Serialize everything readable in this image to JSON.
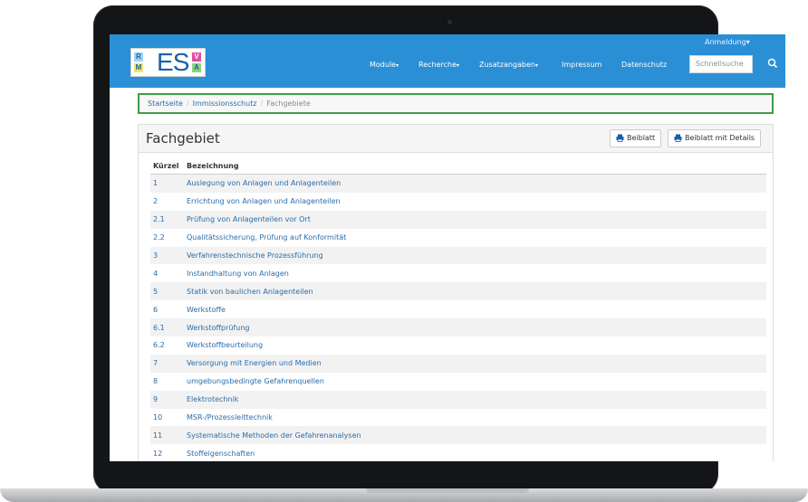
{
  "navbar": {
    "login_label": "Anmeldung",
    "items": [
      {
        "label": "Module",
        "dropdown": true
      },
      {
        "label": "Recherche",
        "dropdown": true
      },
      {
        "label": "Zusatzangaben",
        "dropdown": true
      },
      {
        "label": "Impressum",
        "dropdown": false
      },
      {
        "label": "Datenschutz",
        "dropdown": false
      }
    ],
    "search_placeholder": "Schnellsuche",
    "logo_letters": [
      "R",
      "M",
      "E",
      "S",
      "V",
      "A"
    ],
    "color": "#2b8fd6"
  },
  "breadcrumb": {
    "items": [
      "Startseite",
      "Immissionsschutz",
      "Fachgebiete"
    ],
    "highlight_color": "#3d9d4a"
  },
  "panel": {
    "title": "Fachgebiet",
    "btn_beiblatt": "Beiblatt",
    "btn_beiblatt_details": "Beiblatt mit Details"
  },
  "table": {
    "headers": [
      "Kürzel",
      "Bezeichnung"
    ],
    "rows": [
      {
        "k": "1",
        "b": "Auslegung von Anlagen und Anlagenteilen"
      },
      {
        "k": "2",
        "b": "Errichtung von Anlagen und Anlagenteilen"
      },
      {
        "k": "2.1",
        "b": "Prüfung von Anlagenteilen vor Ort"
      },
      {
        "k": "2.2",
        "b": "Qualitätssicherung, Prüfung auf Konformität"
      },
      {
        "k": "3",
        "b": "Verfahrenstechnische Prozessführung"
      },
      {
        "k": "4",
        "b": "Instandhaltung von Anlagen"
      },
      {
        "k": "5",
        "b": "Statik von baulichen Anlagenteilen"
      },
      {
        "k": "6",
        "b": "Werkstoffe"
      },
      {
        "k": "6.1",
        "b": "Werkstoffprüfung"
      },
      {
        "k": "6.2",
        "b": "Werkstoffbeurteilung"
      },
      {
        "k": "7",
        "b": "Versorgung mit Energien und Medien"
      },
      {
        "k": "8",
        "b": "umgebungsbedingte Gefahrenquellen"
      },
      {
        "k": "9",
        "b": "Elektrotechnik"
      },
      {
        "k": "10",
        "b": "MSR-/Prozessleittechnik"
      },
      {
        "k": "11",
        "b": "Systematische Methoden der Gefahrenanalysen"
      },
      {
        "k": "12",
        "b": "Stoffeigenschaften"
      }
    ]
  }
}
